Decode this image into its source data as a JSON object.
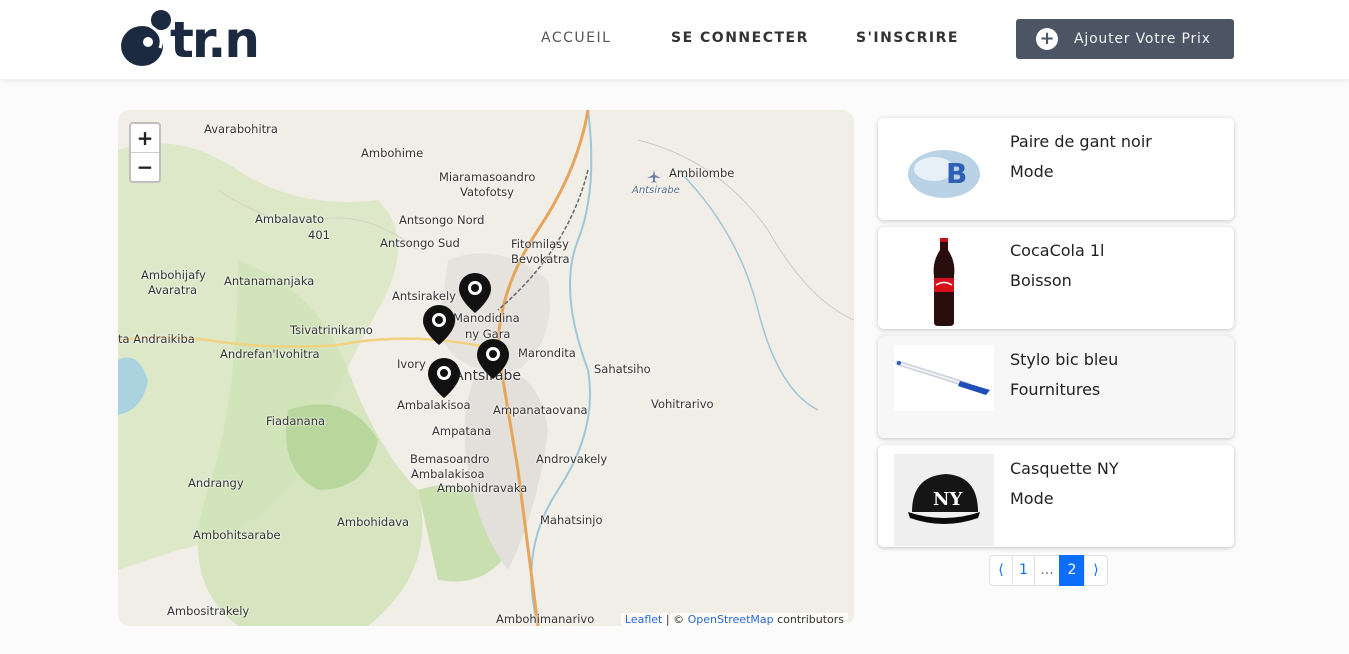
{
  "brand": {
    "logo_text": "tr.n"
  },
  "nav": {
    "home": "ACCUEIL",
    "login": "SE CONNECTER",
    "signup": "S'INSCRIRE",
    "add_price": "Ajouter Votre Prix"
  },
  "map": {
    "zoom_in": "+",
    "zoom_out": "−",
    "places": [
      "Avarabohitra",
      "Ambohime",
      "Miaramasoandro",
      "Vatofotsy",
      "Ambilombe",
      "Antsirabe",
      "Ambalavato",
      "401",
      "Antsongo Nord",
      "Antsongo Sud",
      "Fitomilasy",
      "Bevokatra",
      "Ambohijafy",
      "Avaratra",
      "Antanamanjaka",
      "Antsirakely",
      "Manodidina",
      "ny Gara",
      "Tsivatrinikamo",
      "ta Andraikiba",
      "Andrefan'Ivohitra",
      "Ivory",
      "Antsirabe",
      "Marondita",
      "Sahatsiho",
      "Ambalakisoa",
      "Ampanataovana",
      "Vohitrarivo",
      "Fiadanana",
      "Ampatana",
      "Bemasoandro",
      "Ambalakisoa",
      "Androvakely",
      "Andrangy",
      "Ambohidravaka",
      "Ambohidava",
      "Mahatsinjo",
      "Ambohitsarabe",
      "Ambositrakely",
      "Ambohimanarivo"
    ],
    "attribution": {
      "leaflet": "Leaflet",
      "sep": " | © ",
      "osm": "OpenStreetMap",
      "suffix": " contributors"
    }
  },
  "products": [
    {
      "name": "Paire de gant noir",
      "category": "Mode",
      "image_icon": "glove-pack-image"
    },
    {
      "name": "CocaCola 1l",
      "category": "Boisson",
      "image_icon": "cola-bottle-image"
    },
    {
      "name": "Stylo bic bleu",
      "category": "Fournitures",
      "image_icon": "pen-image"
    },
    {
      "name": "Casquette NY",
      "category": "Mode",
      "image_icon": "cap-image"
    }
  ],
  "pagination": {
    "prev": "⟨",
    "page1": "1",
    "dots": "...",
    "page2": "2",
    "next": "⟩",
    "current": 2
  },
  "colors": {
    "dark_button": "#4b5563",
    "pager_active": "#0d6efd",
    "logo": "#1b2a40"
  }
}
